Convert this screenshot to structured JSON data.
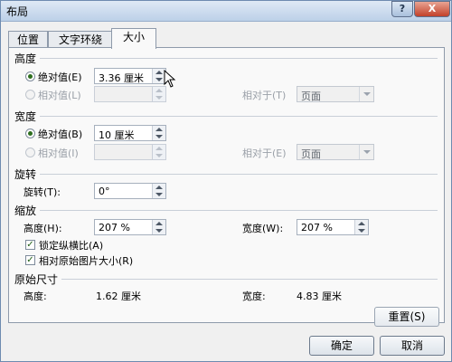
{
  "window": {
    "title": "布局",
    "help_label": "?",
    "close_label": "X"
  },
  "tabs": [
    {
      "label": "位置",
      "active": false
    },
    {
      "label": "文字环绕",
      "active": false
    },
    {
      "label": "大小",
      "active": true
    }
  ],
  "height": {
    "section": "高度",
    "absolute_label": "绝对值(E)",
    "absolute_value": "3.36 厘米",
    "relative_label": "相对值(L)",
    "relative_to_label": "相对于(T)",
    "relative_to_value": "页面"
  },
  "width": {
    "section": "宽度",
    "absolute_label": "绝对值(B)",
    "absolute_value": "10 厘米",
    "relative_label": "相对值(I)",
    "relative_to_label": "相对于(E)",
    "relative_to_value": "页面"
  },
  "rotation": {
    "section": "旋转",
    "label": "旋转(T):",
    "value": "0°"
  },
  "scale": {
    "section": "缩放",
    "height_label": "高度(H):",
    "height_value": "207 %",
    "width_label": "宽度(W):",
    "width_value": "207 %",
    "lock_label": "锁定纵横比(A)",
    "relative_label": "相对原始图片大小(R)"
  },
  "original": {
    "section": "原始尺寸",
    "height_label": "高度:",
    "height_value": "1.62 厘米",
    "width_label": "宽度:",
    "width_value": "4.83 厘米"
  },
  "buttons": {
    "reset": "重置(S)",
    "ok": "确定",
    "cancel": "取消"
  }
}
